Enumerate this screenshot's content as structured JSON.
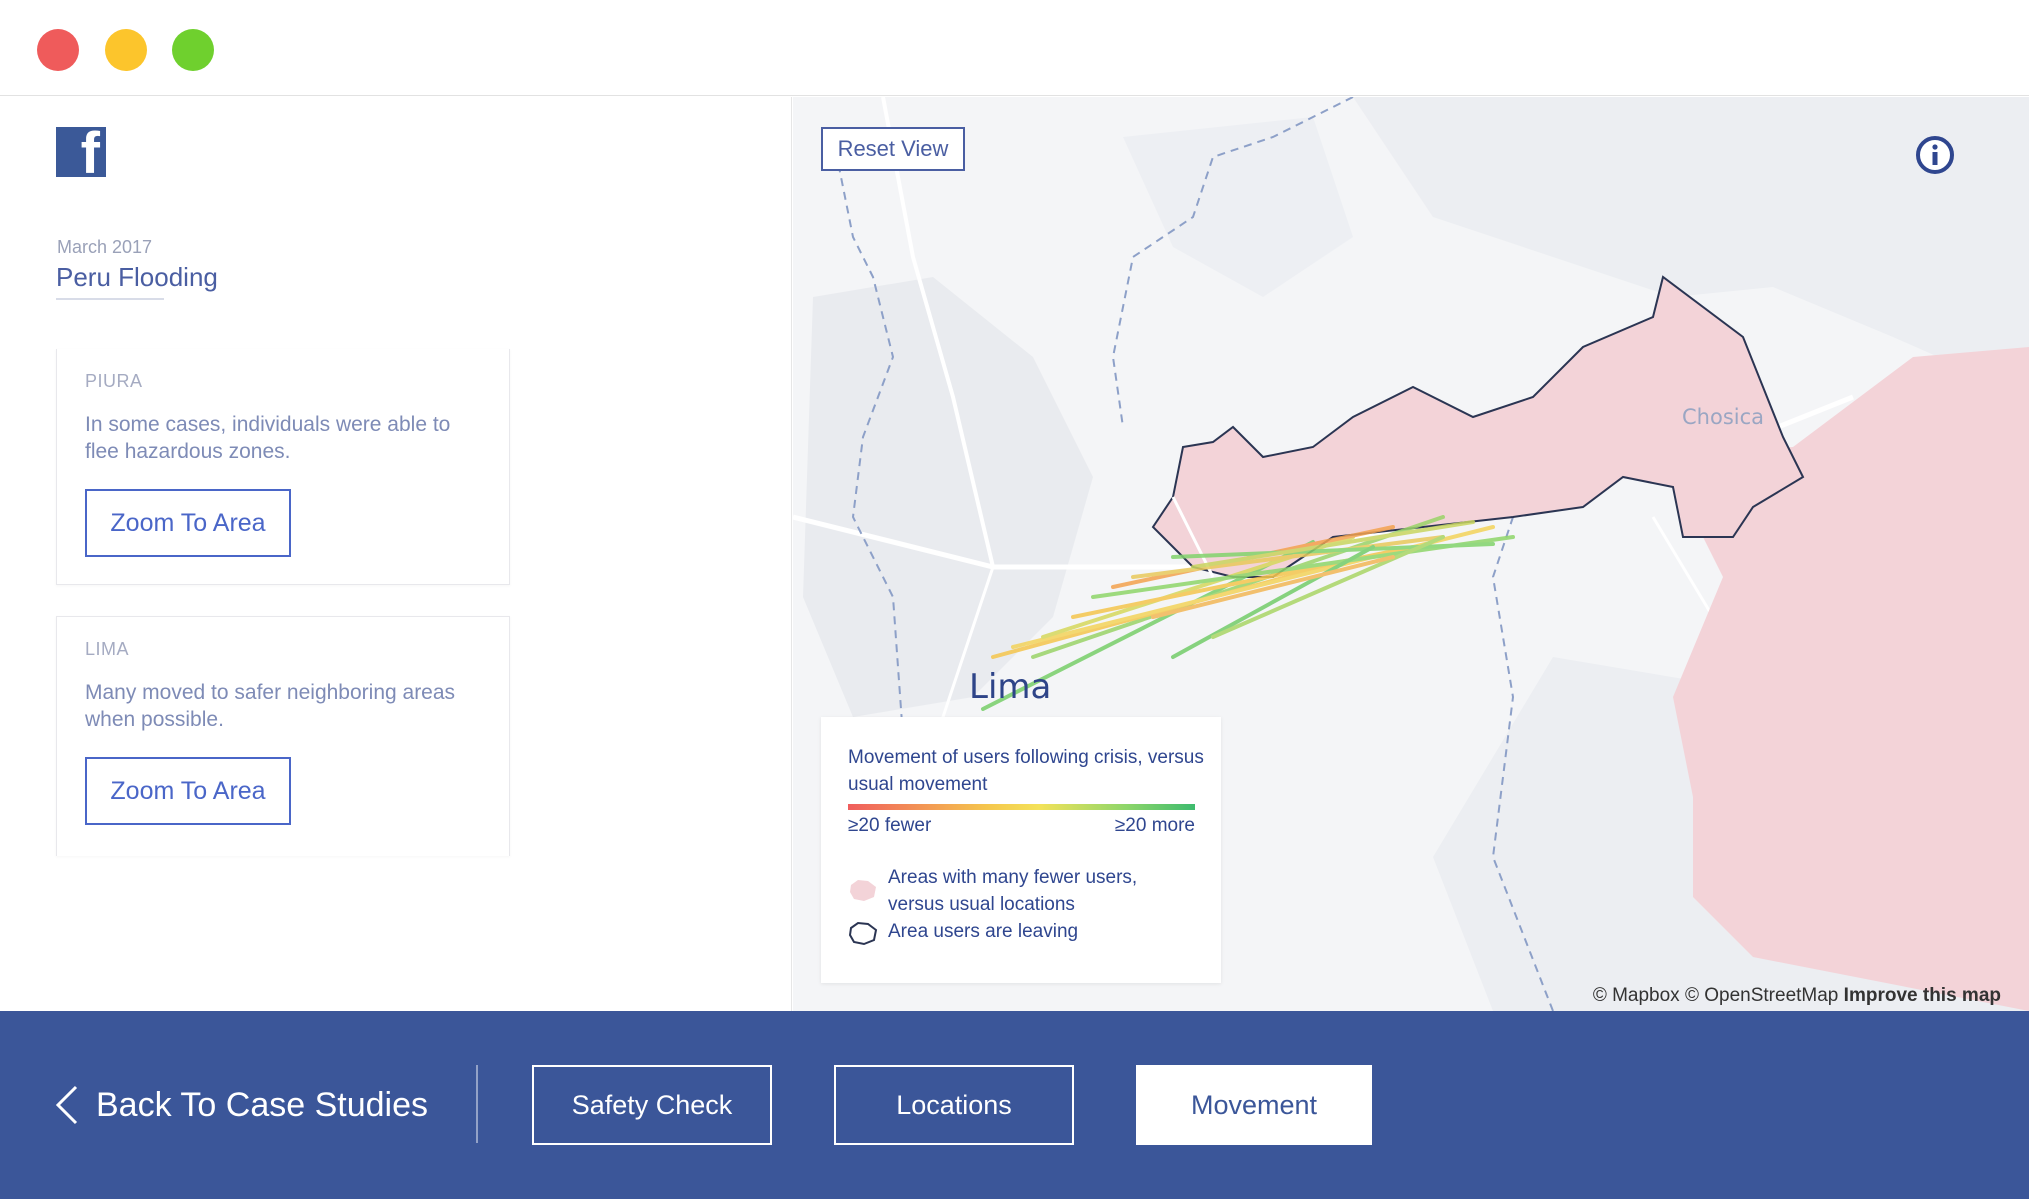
{
  "window": {
    "controls": [
      "close",
      "minimize",
      "maximize"
    ]
  },
  "sidebar": {
    "logo_icon": "facebook-logo-icon",
    "date": "March 2017",
    "title": "Peru Flooding",
    "cards": [
      {
        "region": "PIURA",
        "description": "In some cases, individuals were able to flee hazardous zones.",
        "button": "Zoom To Area"
      },
      {
        "region": "LIMA",
        "description": "Many moved to safer neighboring areas when possible.",
        "button": "Zoom To Area"
      }
    ]
  },
  "map": {
    "reset_button": "Reset View",
    "info_icon": "info-circle-icon",
    "labels": {
      "lima": "Lima",
      "chosica": "Chosica"
    },
    "attribution": {
      "mapbox": "© Mapbox",
      "osm": "© OpenStreetMap",
      "improve": "Improve this map"
    },
    "legend": {
      "heading": "Movement of users following crisis, versus usual movement",
      "scale_low": "≥20 fewer",
      "scale_high": "≥20 more",
      "area_label": "Areas with many fewer users, versus usual locations",
      "outline_label": "Area users are leaving"
    },
    "colors": {
      "area_fill": "#f3d3d8",
      "outline": "#2b3553",
      "low": "#f05d5d",
      "mid": "#f5c64d",
      "high": "#3dbb6e"
    }
  },
  "footer": {
    "back_label": "Back To Case Studies",
    "tabs": [
      "Safety Check",
      "Locations",
      "Movement"
    ],
    "active_tab": "Movement"
  }
}
